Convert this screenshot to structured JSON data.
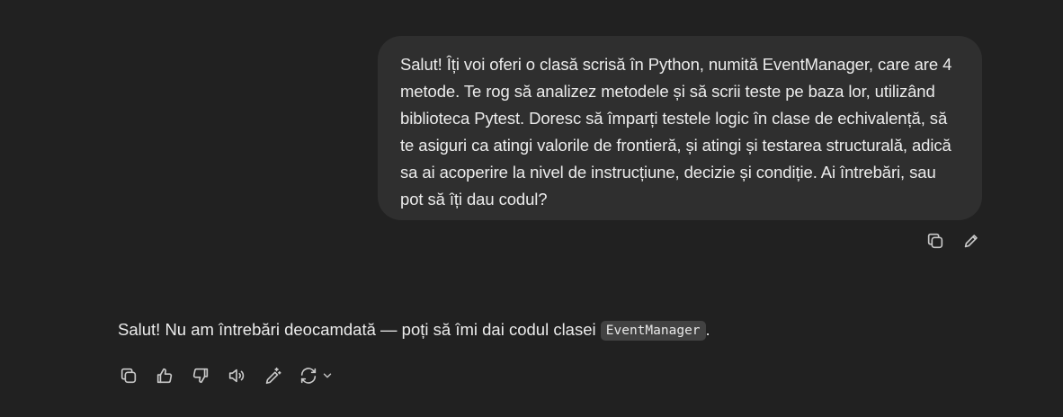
{
  "user_message": {
    "text": "Salut! Îți voi oferi o clasă scrisă în Python, numită EventManager, care are 4 metode. Te rog să analizez metodele și să scrii teste pe baza lor, utilizând biblioteca Pytest. Doresc să împarți testele logic în clase de echivalență, să te asiguri ca atingi valorile de frontieră, și atingi și testarea structurală, adică sa ai acoperire la nivel de instrucțiune, decizie și condiție. Ai întrebări, sau pot să îți dau codul?",
    "actions": [
      "copy-icon",
      "edit-icon"
    ]
  },
  "assistant_message": {
    "text_before": "Salut! Nu am întrebări deocamdată — poți să îmi dai codul clasei ",
    "code": "EventManager",
    "text_after": ".",
    "actions": [
      "copy-icon",
      "thumbs-up-icon",
      "thumbs-down-icon",
      "read-aloud-icon",
      "edit-sparkle-icon",
      "regenerate-icon",
      "chevron-down-icon"
    ]
  }
}
